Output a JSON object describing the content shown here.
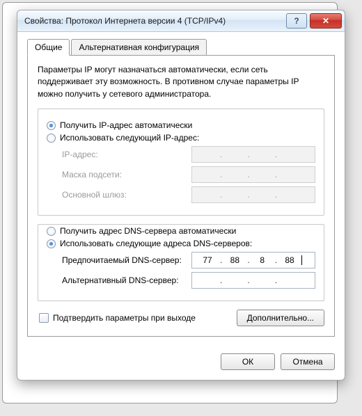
{
  "window": {
    "title": "Свойства: Протокол Интернета версии 4 (TCP/IPv4)"
  },
  "tabs": {
    "general": "Общие",
    "alt": "Альтернативная конфигурация"
  },
  "description": "Параметры IP могут назначаться автоматически, если сеть поддерживает эту возможность. В противном случае параметры IP можно получить у сетевого администратора.",
  "ip": {
    "auto": "Получить IP-адрес автоматически",
    "manual": "Использовать следующий IP-адрес:",
    "addr_label": "IP-адрес:",
    "mask_label": "Маска подсети:",
    "gw_label": "Основной шлюз:"
  },
  "dns": {
    "auto": "Получить адрес DNS-сервера автоматически",
    "manual": "Использовать следующие адреса DNS-серверов:",
    "pref_label": "Предпочитаемый DNS-сервер:",
    "alt_label": "Альтернативный DNS-сервер:",
    "pref": {
      "o1": "77",
      "o2": "88",
      "o3": "8",
      "o4": "88"
    },
    "altv": {
      "o1": "",
      "o2": "",
      "o3": "",
      "o4": ""
    }
  },
  "validate": "Подтвердить параметры при выходе",
  "advanced": "Дополнительно...",
  "ok": "ОК",
  "cancel": "Отмена"
}
